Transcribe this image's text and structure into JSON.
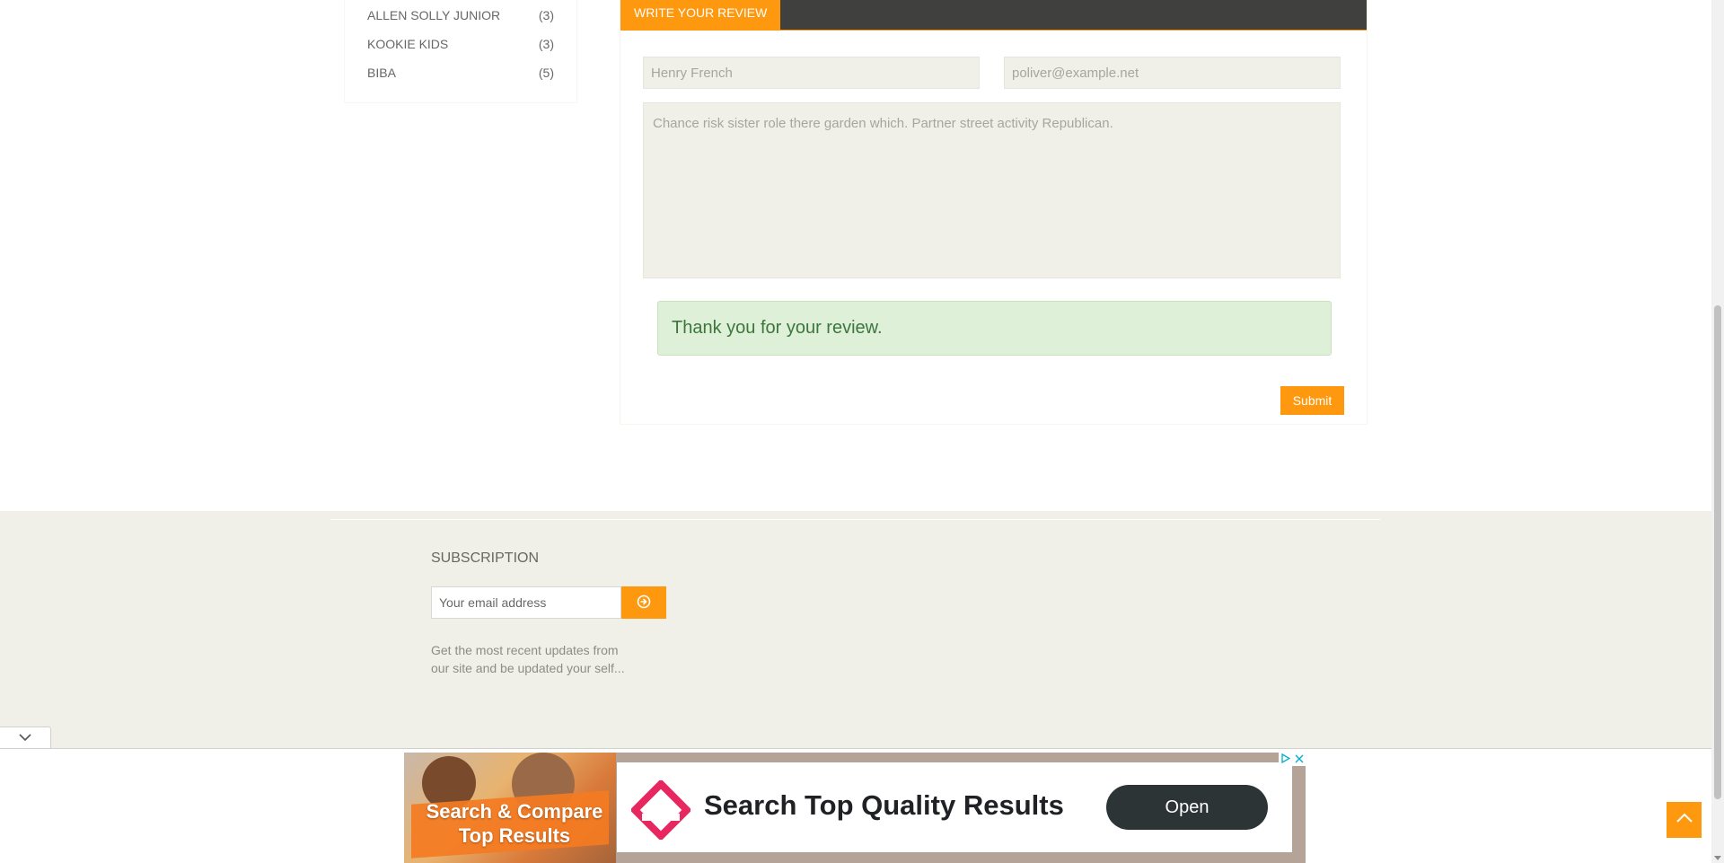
{
  "brands": [
    {
      "name": "ALLEN SOLLY JUNIOR",
      "count": "(3)"
    },
    {
      "name": "KOOKIE KIDS",
      "count": "(3)"
    },
    {
      "name": "BIBA",
      "count": "(5)"
    }
  ],
  "review": {
    "tab_label": "WRITE YOUR REVIEW",
    "name_placeholder": "Henry French",
    "email_placeholder": "poliver@example.net",
    "review_placeholder": "Chance risk sister role there garden which. Partner street activity Republican.",
    "success_message": "Thank you for your review.",
    "submit_label": "Submit"
  },
  "footer": {
    "subscription_title": "SUBSCRIPTION",
    "email_placeholder": "Your email address",
    "description": "Get the most recent updates from our site and be updated your self..."
  },
  "ad": {
    "left_text": "Search & Compare Top Results",
    "headline": "Search Top Quality Results",
    "cta_label": "Open"
  },
  "colors": {
    "accent": "#fe980f",
    "success_bg": "#dff0d8",
    "success_text": "#3c763d",
    "footer_bg": "#f0f0e9",
    "tabbar_bg": "#40403e",
    "ad_logo": "#e8265f"
  },
  "icons": {
    "subscribe": "arrow-circle-right-icon",
    "collapse": "chevron-down-icon",
    "scroll_top": "chevron-up-icon",
    "ad_choices": "adchoices-icon",
    "ad_close": "close-icon"
  }
}
